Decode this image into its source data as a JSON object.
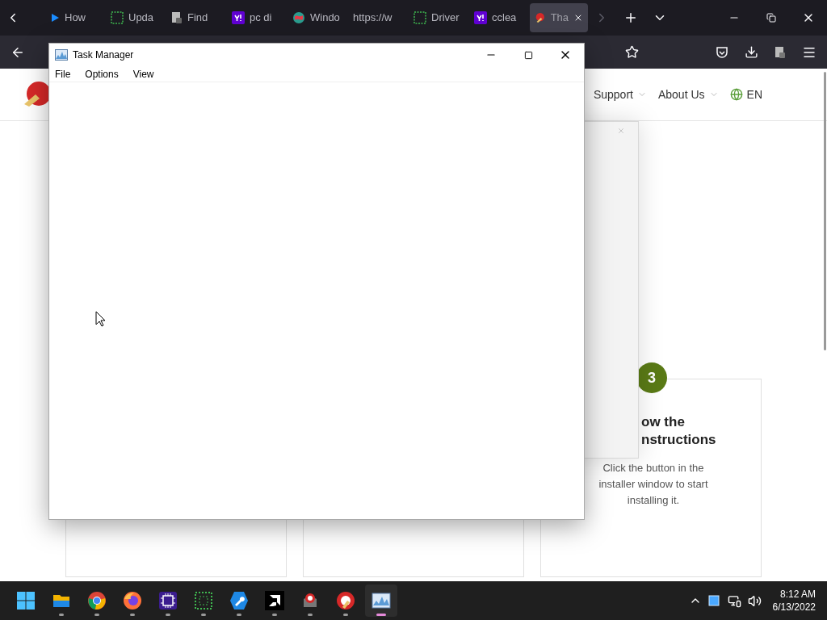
{
  "browser": {
    "tabs": [
      {
        "label": "How",
        "kind": "play",
        "selected": false
      },
      {
        "label": "Upda",
        "kind": "grid",
        "selected": false
      },
      {
        "label": "Find",
        "kind": "doc",
        "selected": false
      },
      {
        "label": "pc di",
        "kind": "yahoo",
        "selected": false
      },
      {
        "label": "Windo",
        "kind": "globe",
        "selected": false
      },
      {
        "label": "https://w",
        "kind": "plain",
        "selected": false
      },
      {
        "label": "Driver",
        "kind": "grid",
        "selected": false
      },
      {
        "label": "cclea",
        "kind": "yahoo",
        "selected": false
      },
      {
        "label": "Tha",
        "kind": "ccleaner",
        "selected": true
      }
    ]
  },
  "page": {
    "nav": [
      {
        "label": "Support",
        "kind": "dropdown"
      },
      {
        "label": "About Us",
        "kind": "dropdown"
      },
      {
        "label": "EN",
        "kind": "language"
      }
    ],
    "step": {
      "number": "3",
      "title_lines": [
        "ow the",
        "nstructions"
      ],
      "text": "Click the button in the installer window to start installing it."
    }
  },
  "task_manager": {
    "title": "Task Manager",
    "menu": [
      "File",
      "Options",
      "View"
    ]
  },
  "taskbar": {
    "apps": [
      {
        "kind": "folder",
        "selected": false
      },
      {
        "kind": "chrome",
        "selected": false
      },
      {
        "kind": "firefox",
        "selected": false
      },
      {
        "kind": "chip",
        "selected": false
      },
      {
        "kind": "dotted",
        "selected": false
      },
      {
        "kind": "wrench",
        "selected": false
      },
      {
        "kind": "amd",
        "selected": false
      },
      {
        "kind": "cleaner-gray",
        "selected": false
      },
      {
        "kind": "cleaner-red",
        "selected": false
      },
      {
        "kind": "taskmgr",
        "selected": true
      }
    ],
    "time": "8:12 AM",
    "date": "6/13/2022"
  }
}
